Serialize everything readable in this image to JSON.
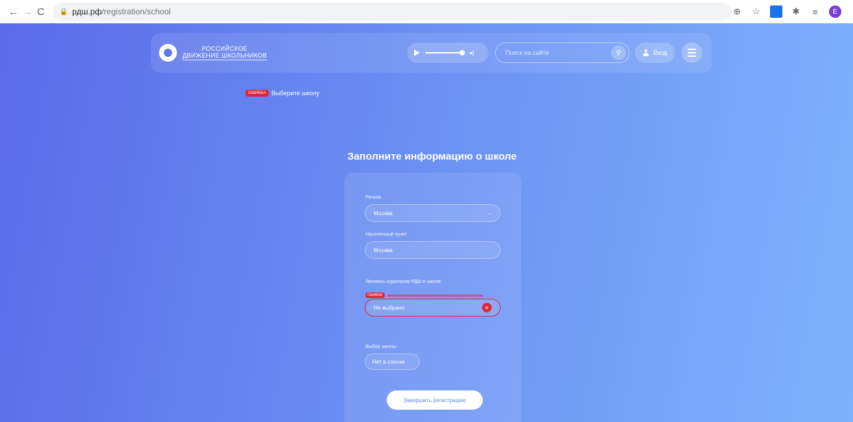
{
  "browser": {
    "url_host": "рдш.рф",
    "url_path": "/registration/school",
    "profile_initial": "E"
  },
  "header": {
    "logo_line1": "РОССИЙСКОЕ",
    "logo_line2": "ДВИЖЕНИЕ ШКОЛЬНИКОВ",
    "search_placeholder": "Поиск на сайте",
    "login_label": "Вход"
  },
  "error_banner": {
    "badge": "ошибка",
    "text": "Выберите школу"
  },
  "form": {
    "title": "Заполните информацию о школе",
    "region": {
      "label": "Регион",
      "value": "Москва"
    },
    "locality": {
      "label": "Населенный пункт",
      "value": "Москва"
    },
    "curator": {
      "label": "Являюсь куратором РДШ в школе",
      "error_badge": "ошибка",
      "value": "Не выбрано"
    },
    "school": {
      "label": "Выбор школы",
      "value": "Нет в списке"
    },
    "submit_label": "Завершить регистрацию"
  },
  "colors": {
    "gradient_start": "#5b6ae8",
    "gradient_end": "#7fb2fb",
    "error": "#e02637"
  }
}
